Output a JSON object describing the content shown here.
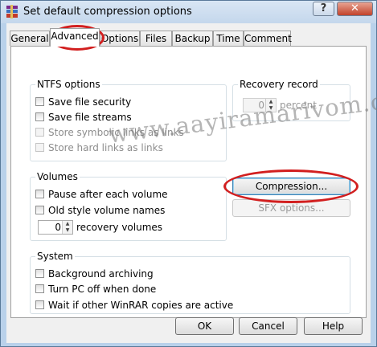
{
  "window": {
    "title": "Set default compression options",
    "help_glyph": "?",
    "close_glyph": "✕",
    "icon": "winrar-books-icon"
  },
  "tabs": [
    {
      "label": "General",
      "active": false
    },
    {
      "label": "Advanced",
      "active": true
    },
    {
      "label": "Options",
      "active": false
    },
    {
      "label": "Files",
      "active": false
    },
    {
      "label": "Backup",
      "active": false
    },
    {
      "label": "Time",
      "active": false
    },
    {
      "label": "Comment",
      "active": false
    }
  ],
  "ntfs": {
    "label": "NTFS options",
    "items": [
      {
        "label": "Save file security",
        "checked": false,
        "enabled": true
      },
      {
        "label": "Save file streams",
        "checked": false,
        "enabled": true
      },
      {
        "label": "Store symbolic links as links",
        "checked": false,
        "enabled": false
      },
      {
        "label": "Store hard links as links",
        "checked": false,
        "enabled": false
      }
    ]
  },
  "recovery": {
    "label": "Recovery record",
    "value": "0",
    "unit": "percent"
  },
  "volumes": {
    "label": "Volumes",
    "items": [
      {
        "label": "Pause after each volume",
        "checked": false
      },
      {
        "label": "Old style volume names",
        "checked": false
      }
    ],
    "recovery_volumes_value": "0",
    "recovery_volumes_label": "recovery volumes"
  },
  "buttons": {
    "compression": "Compression...",
    "sfx_options": "SFX options...",
    "ok": "OK",
    "cancel": "Cancel",
    "help": "Help"
  },
  "system": {
    "label": "System",
    "items": [
      {
        "label": "Background archiving",
        "checked": false
      },
      {
        "label": "Turn PC off when done",
        "checked": false
      },
      {
        "label": "Wait if other WinRAR copies are active",
        "checked": false
      }
    ]
  },
  "watermark": "www.aayiramarivom.com",
  "colors": {
    "highlight": "#d21f1f",
    "frame": "#b9d1ea"
  }
}
